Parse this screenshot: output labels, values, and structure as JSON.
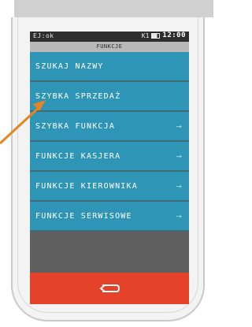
{
  "status": {
    "left": "EJ:ok",
    "battery_label": "K1",
    "time": "12:00"
  },
  "screen_title": "FUNKCJE",
  "menu": [
    {
      "label": "SZUKAJ NAZWY",
      "arrow": ""
    },
    {
      "label": "SZYBKA SPRZEDAŻ",
      "arrow": ""
    },
    {
      "label": "SZYBKA FUNKCJA",
      "arrow": "→"
    },
    {
      "label": "FUNKCJE KASJERA",
      "arrow": "→"
    },
    {
      "label": "FUNKCJE KIEROWNIKA",
      "arrow": "→"
    },
    {
      "label": "FUNKCJE SERWISOWE",
      "arrow": "→"
    }
  ],
  "colors": {
    "accent": "#2f95b6",
    "back": "#e54329",
    "pointer": "#e8841f"
  }
}
